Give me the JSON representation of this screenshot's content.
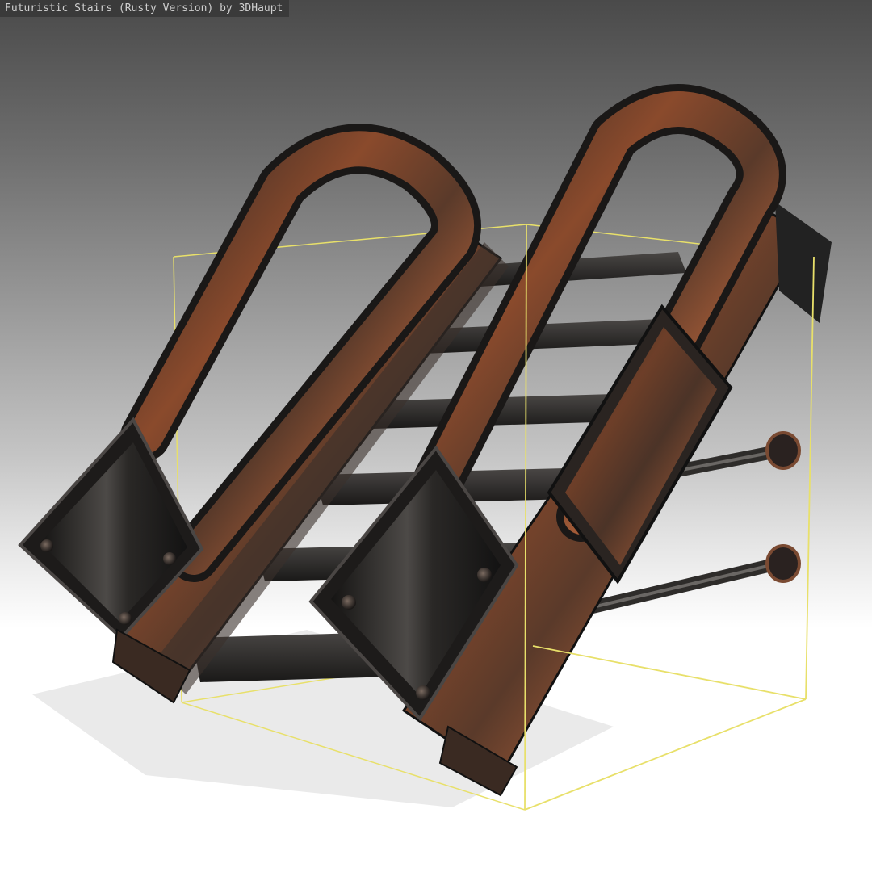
{
  "viewer": {
    "title": "Futuristic Stairs (Rusty Version) by 3DHaupt"
  },
  "scene": {
    "object": "futuristic-rusty-stairs",
    "selection_box_color": "#e8e06a",
    "metal_dark": "#1e1d1c",
    "metal_mid": "#3a3836",
    "rust": "#8a4a2c",
    "rust_light": "#b0653d"
  }
}
